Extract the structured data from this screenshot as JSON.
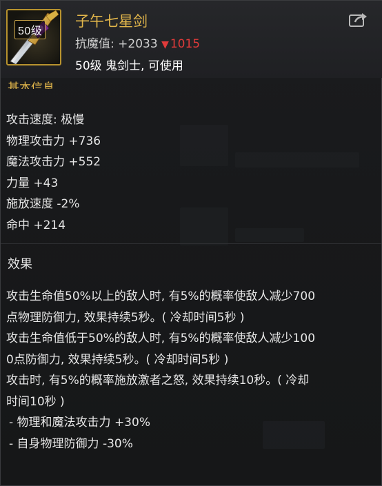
{
  "item": {
    "level_badge": "50级",
    "name": "子午七星剑",
    "resist_label": "抗魔值: ",
    "resist_value": "+2033",
    "resist_change_arrow": "▼",
    "resist_change_value": "1015",
    "requirement": "50级 鬼剑士, 可使用",
    "icon": "sword-icon"
  },
  "share_icon": "share-icon",
  "basic_info": {
    "title": "基本信息",
    "stats": [
      "攻击速度: 极慢",
      "物理攻击力 +736",
      "魔法攻击力 +552",
      "力量 +43",
      "施放速度 -2%",
      "命中 +214"
    ]
  },
  "effects": {
    "title": "效果",
    "lines": [
      "攻击生命值50%以上的敌人时, 有5%的概率使敌人减少700",
      "点物理防御力, 效果持续5秒。( 冷却时间5秒 )",
      "攻击生命值低于50%的敌人时, 有5%的概率使敌人减少100",
      "0点防御力, 效果持续5秒。( 冷却时间5秒 )",
      "攻击时, 有5%的概率施放激者之怒, 效果持续10秒。( 冷却",
      "时间10秒 )",
      " - 物理和魔法攻击力 +30%",
      " - 自身物理防御力 -30%"
    ]
  },
  "colors": {
    "name_gold": "#e2b64b",
    "decrease_red": "#e03a3a",
    "frame_gold": "#b8932e"
  }
}
